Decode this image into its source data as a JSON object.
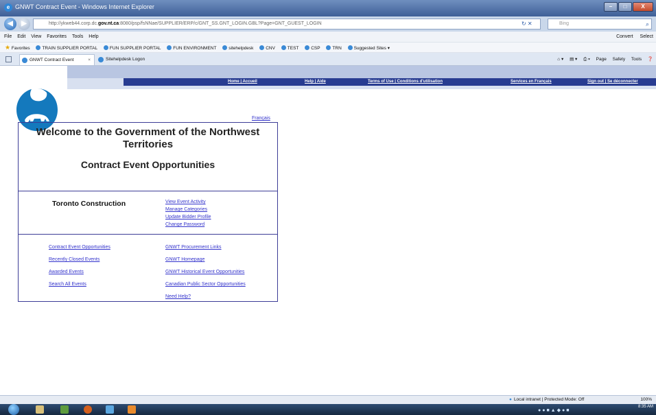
{
  "window": {
    "title": "GNWT Contract Event - Windows Internet Explorer",
    "buttons": [
      "–",
      "□",
      "X"
    ]
  },
  "address": {
    "url_prefix": "http://ykweb44.corp.dc.",
    "url_host": "gov.nt.ca",
    "url_rest": ":8080/psp/fsNNae/SUPPLIER/ERP/c/GNT_SS.GNT_LOGIN.GBL?Page=GNT_GUEST_LOGIN",
    "search_placeholder": "Bing"
  },
  "menu": {
    "items": [
      "File",
      "Edit",
      "View",
      "Favorites",
      "Tools",
      "Help"
    ],
    "right": [
      "Convert",
      "Select"
    ]
  },
  "favorites": {
    "label": "Favorites",
    "items": [
      "TRAIN SUPPLIER PORTAL",
      "FUN SUPPLIER PORTAL",
      "FUN ENVIRONMENT",
      "sitehelpdesk",
      "CNV",
      "TEST",
      "CSP",
      "TRN",
      "Suggested Sites"
    ]
  },
  "tabs": [
    {
      "label": "GNWT Contract Event",
      "active": true
    },
    {
      "label": "Sitehelpdesk Logon",
      "active": false
    }
  ],
  "tab_tools": [
    "Page",
    "Safety",
    "Tools"
  ],
  "page": {
    "nav": [
      "Home | Accueil",
      "Help | Aide",
      "Terms of Use | Conditions d'utilisation",
      "Services en Français",
      "Sign out | Se déconnecter"
    ],
    "francais_link": "Français",
    "welcome_title": "Welcome to the Government of the Northwest Territories",
    "subtitle": "Contract Event Opportunities",
    "company": "Toronto Construction",
    "account_links": [
      "View Event Activity",
      "Manage Categories",
      "Update Bidder Profile",
      "Change Password"
    ],
    "events_links": [
      "Contract Event Opportunities",
      "Recently Closed Events",
      "Awarded Events",
      "Search All Events"
    ],
    "resource_links": [
      "GNWT Procurement Links",
      "GNWT Homepage",
      "GNWT Historical Event Opportunities",
      "Canadian Public Sector Opportunities",
      "Need Help?"
    ],
    "colors": {
      "nav_bar": "#283c91",
      "logo_blue": "#1479bd",
      "link": "#3333cc",
      "box_border": "#3c3c96"
    }
  },
  "status": {
    "zone": "Local intranet | Protected Mode: Off",
    "zoom": "100%"
  },
  "taskbar": {
    "time": "8:35 AM"
  }
}
